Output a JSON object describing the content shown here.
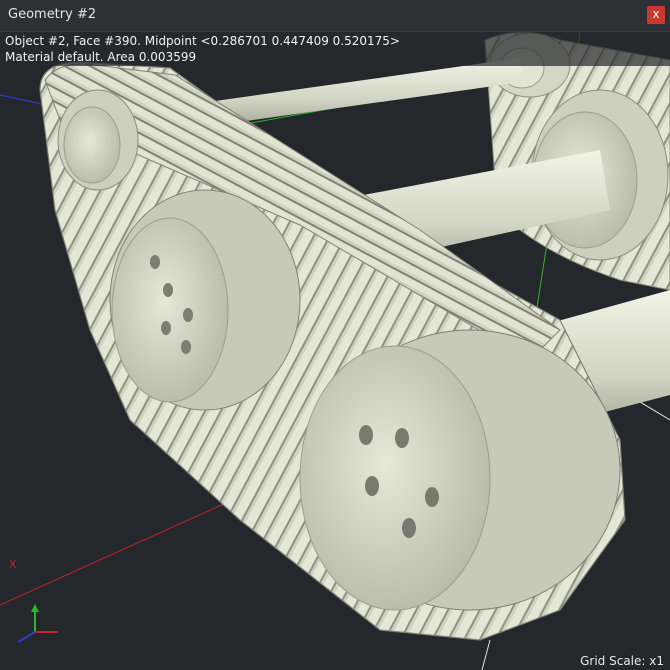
{
  "window": {
    "title": "Geometry #2",
    "close_label": "x"
  },
  "info": {
    "line1": "Object #2, Face #390. Midpoint <0.286701  0.447409  0.520175>",
    "line2": "Material default. Area 0.003599"
  },
  "viewport": {
    "grid_scale": "Grid Scale: x1",
    "axis_x_label": "X",
    "model_color": "#d9dccb",
    "background_color": "#24272b",
    "axis_colors": {
      "x": "#c0262a",
      "y": "#2fb52f",
      "z": "#2a3fc8"
    }
  }
}
